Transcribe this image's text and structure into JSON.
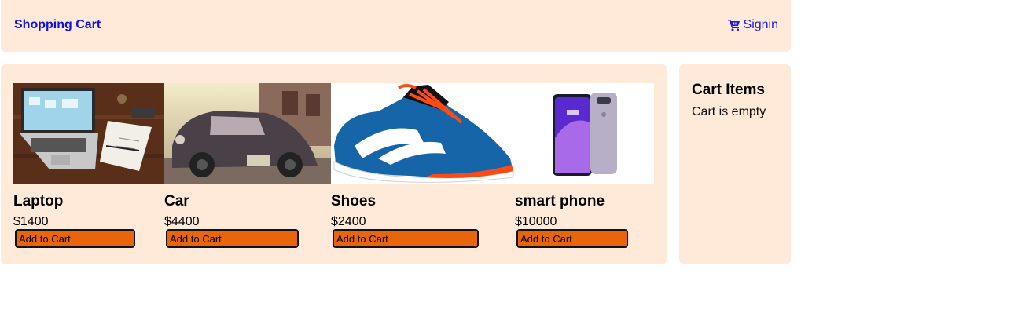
{
  "header": {
    "brand": "Shopping Cart",
    "signin_label": "Signin"
  },
  "products": [
    {
      "name": "Laptop",
      "price": "$1400",
      "button": "Add to Cart"
    },
    {
      "name": "Car",
      "price": "$4400",
      "button": "Add to Cart"
    },
    {
      "name": "Shoes",
      "price": "$2400",
      "button": "Add to Cart"
    },
    {
      "name": "smart phone",
      "price": "$10000",
      "button": "Add to Cart"
    }
  ],
  "cart": {
    "title": "Cart Items",
    "status": "Cart is empty"
  },
  "colors": {
    "panel_bg": "#ffe9d8",
    "link": "#1010e0",
    "button_bg": "#e8650a"
  },
  "icons": {
    "signin": "shopping-cart-icon"
  }
}
